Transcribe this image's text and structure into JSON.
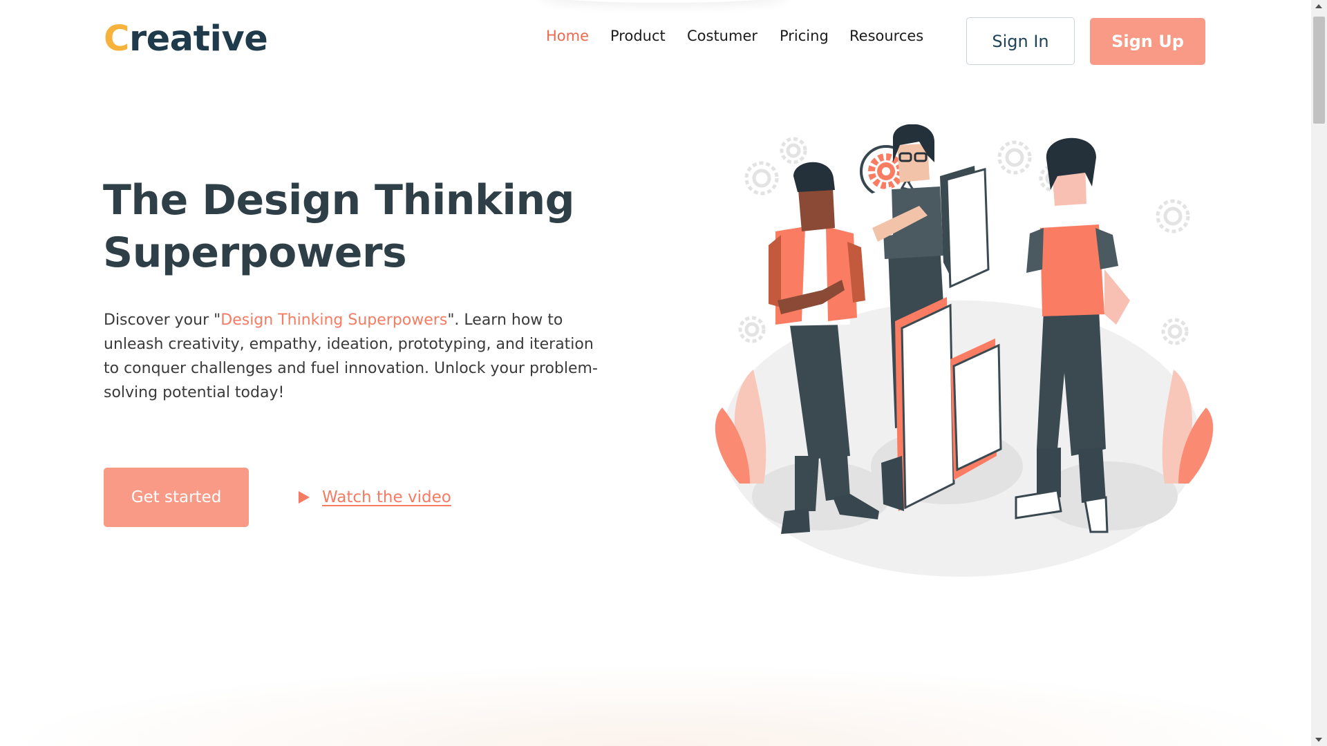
{
  "brand": {
    "logo_first_letter": "C",
    "logo_rest": "reative",
    "logo_letter_color": "#f7b23b",
    "logo_text_color": "#1f3a4a"
  },
  "nav": {
    "items": [
      {
        "label": "Home",
        "active": true
      },
      {
        "label": "Product",
        "active": false
      },
      {
        "label": "Costumer",
        "active": false
      },
      {
        "label": "Pricing",
        "active": false
      },
      {
        "label": "Resources",
        "active": false
      }
    ],
    "active_color": "#f0684e"
  },
  "auth": {
    "signin_label": "Sign In",
    "signup_label": "Sign Up"
  },
  "hero": {
    "title_line1": "The Design Thinking",
    "title_line2": "Superpowers",
    "desc_prefix": "Discover your \"",
    "desc_highlight": "Design Thinking Superpowers",
    "desc_suffix": "\". Learn how to unleash creativity, empathy, ideation, prototyping, and iteration to conquer challenges and fuel innovation. Unlock your problem-solving potential today!",
    "cta_label": "Get started",
    "video_link_label": "Watch the video"
  },
  "illustration": {
    "name": "team-with-puzzle-illustration",
    "accent_color": "#fa7d63",
    "dark_color": "#3b4a51"
  },
  "colors": {
    "accent": "#f89a85",
    "heading": "#2e3f48"
  }
}
